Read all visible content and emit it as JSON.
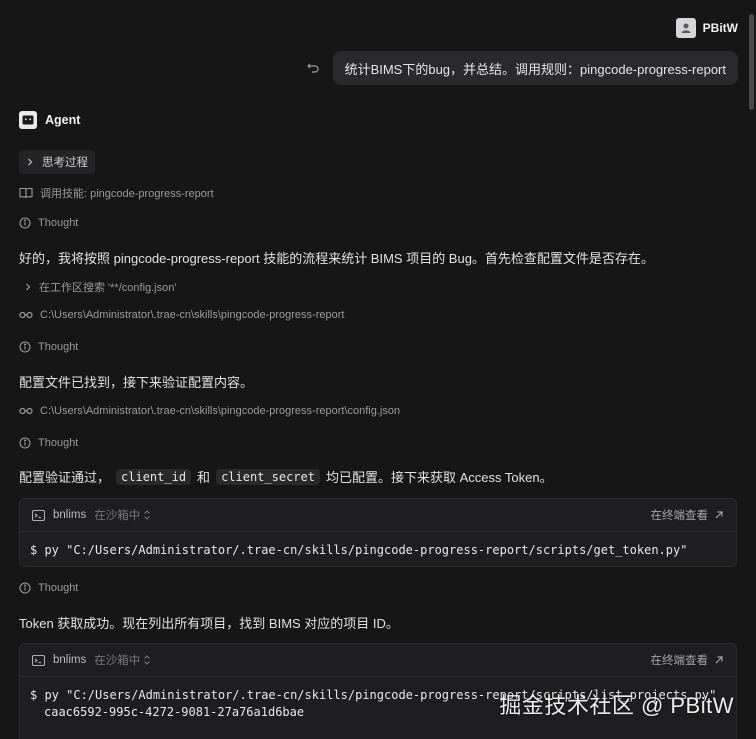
{
  "user": {
    "name": "PBitW",
    "message": "统计BIMS下的bug，并总结。调用规则：pingcode-progress-report"
  },
  "agent": {
    "name": "Agent",
    "thinking_label": "思考过程",
    "skill_call": "调用技能: pingcode-progress-report",
    "thought1": "Thought",
    "text1": "好的，我将按照 pingcode-progress-report 技能的流程来统计 BIMS 项目的 Bug。首先检查配置文件是否存在。",
    "search": "在工作区搜索 '**/config.json'",
    "path1": "C:\\Users\\Administrator\\.trae-cn\\skills\\pingcode-progress-report",
    "thought2": "Thought",
    "text2": "配置文件已找到，接下来验证配置内容。",
    "path2": "C:\\Users\\Administrator\\.trae-cn\\skills\\pingcode-progress-report\\config.json",
    "thought3": "Thought",
    "text3_a": "配置验证通过，",
    "text3_code1": "client_id",
    "text3_b": "和",
    "text3_code2": "client_secret",
    "text3_c": "均已配置。接下来获取 Access Token。",
    "thought4": "Thought",
    "text4": "Token 获取成功。现在列出所有项目，找到 BIMS 对应的项目 ID。"
  },
  "terminal1": {
    "title": "bnlims",
    "sandbox": "在沙箱中",
    "view_label": "在终端查看",
    "command": "$ py \"C:/Users/Administrator/.trae-cn/skills/pingcode-progress-report/scripts/get_token.py\""
  },
  "terminal2": {
    "title": "bnlims",
    "sandbox": "在沙箱中",
    "view_label": "在终端查看",
    "command": "$ py \"C:/Users/Administrator/.trae-cn/skills/pingcode-progress-report/scripts/list_projects.py\"",
    "output": "caac6592-995c-4272-9081-27a76a1d6bae"
  },
  "watermark": "掘金技术社区 @ PBitW"
}
